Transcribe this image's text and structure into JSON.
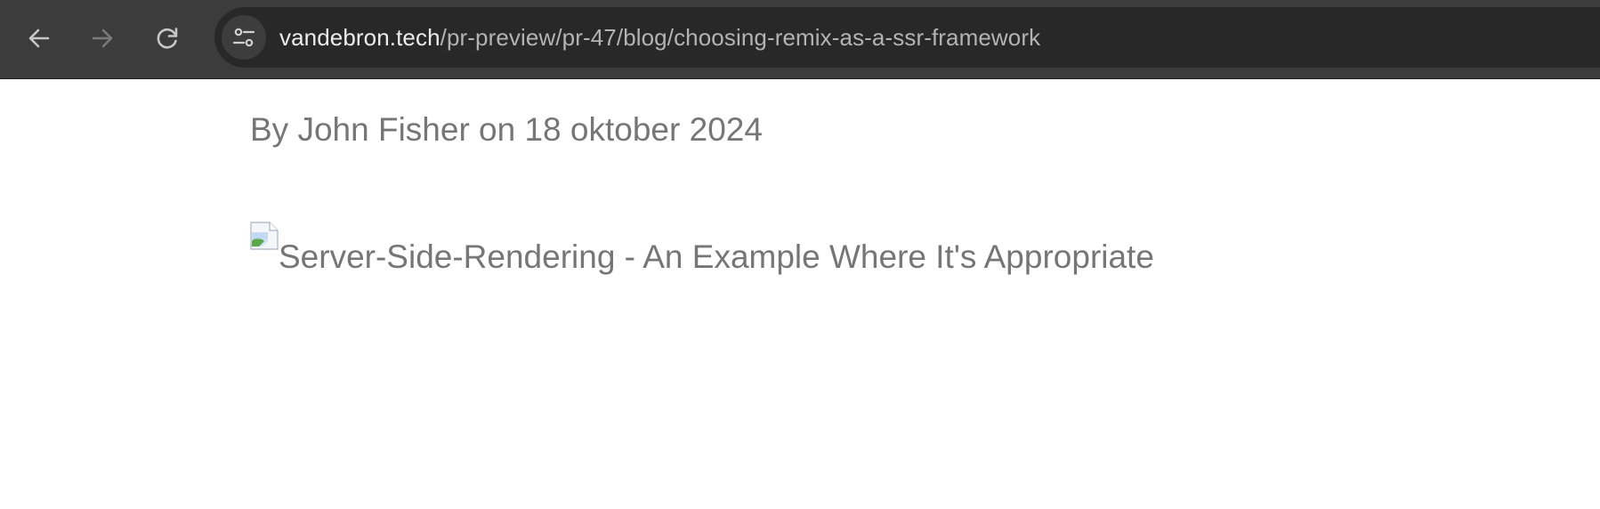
{
  "browser": {
    "url_domain": "vandebron.tech",
    "url_path": "/pr-preview/pr-47/blog/choosing-remix-as-a-ssr-framework",
    "icons": {
      "back": "arrow-left-icon",
      "forward": "arrow-right-icon",
      "reload": "reload-icon",
      "site_info": "tune-icon"
    }
  },
  "article": {
    "byline": "By John Fisher on 18 oktober 2024",
    "hero_image_alt": "Server-Side-Rendering - An Example Where It's Appropriate",
    "hero_image_icon": "broken-image-icon"
  },
  "colors": {
    "toolbar_bg": "#3c3c3c",
    "omnibox_bg": "#282828",
    "text_gray": "#767676"
  }
}
